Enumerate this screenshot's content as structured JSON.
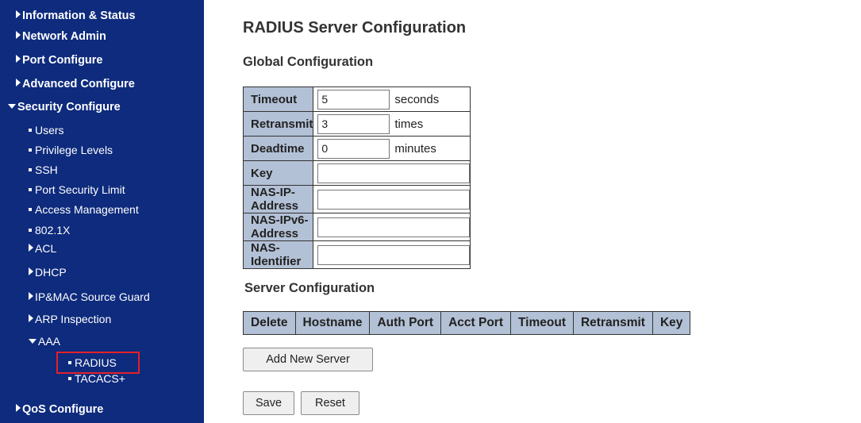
{
  "sidebar": {
    "items": [
      {
        "label": "Information & Status"
      },
      {
        "label": "Network Admin"
      },
      {
        "label": "Port Configure"
      },
      {
        "label": "Advanced Configure"
      },
      {
        "label": "Security Configure"
      },
      {
        "label": "Users"
      },
      {
        "label": "Privilege Levels"
      },
      {
        "label": "SSH"
      },
      {
        "label": "Port Security Limit"
      },
      {
        "label": "Access Management"
      },
      {
        "label": "802.1X"
      },
      {
        "label": "ACL"
      },
      {
        "label": "DHCP"
      },
      {
        "label": "IP&MAC Source Guard"
      },
      {
        "label": "ARP Inspection"
      },
      {
        "label": "AAA"
      },
      {
        "label": "RADIUS"
      },
      {
        "label": "TACACS+"
      },
      {
        "label": "QoS Configure"
      }
    ]
  },
  "page": {
    "title": "RADIUS Server Configuration",
    "global_heading": "Global Configuration",
    "server_heading": "Server Configuration"
  },
  "global": {
    "timeout": {
      "label": "Timeout",
      "value": "5",
      "unit": "seconds"
    },
    "retransmit": {
      "label": "Retransmit",
      "value": "3",
      "unit": "times"
    },
    "deadtime": {
      "label": "Deadtime",
      "value": "0",
      "unit": "minutes"
    },
    "key": {
      "label": "Key",
      "value": ""
    },
    "nas_ip": {
      "label": "NAS-IP-Address",
      "value": ""
    },
    "nas_ipv6": {
      "label": "NAS-IPv6-Address",
      "value": ""
    },
    "nas_id": {
      "label": "NAS-Identifier",
      "value": ""
    }
  },
  "server_table": {
    "columns": [
      "Delete",
      "Hostname",
      "Auth Port",
      "Acct Port",
      "Timeout",
      "Retransmit",
      "Key"
    ]
  },
  "buttons": {
    "add_server": "Add New Server",
    "save": "Save",
    "reset": "Reset"
  },
  "colors": {
    "sidebar_bg": "#0e2b7d",
    "header_cell_bg": "#b3c1d6",
    "highlight_border": "#e5202a"
  }
}
